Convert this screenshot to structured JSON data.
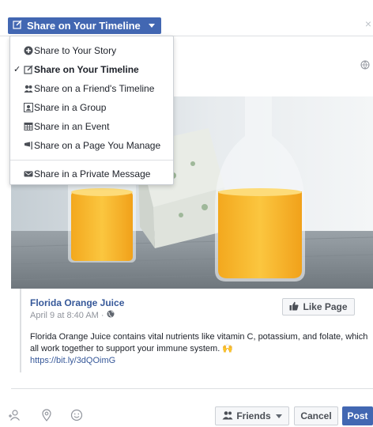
{
  "header": {
    "share_button_label": "Share on Your Timeline",
    "close_label": "×"
  },
  "dropdown": {
    "items": [
      {
        "label": "Share to Your Story",
        "icon": "plus-circle-icon",
        "active": false
      },
      {
        "label": "Share on Your Timeline",
        "icon": "pencil-icon",
        "active": true
      },
      {
        "label": "Share on a Friend's Timeline",
        "icon": "people-icon",
        "active": false
      },
      {
        "label": "Share in a Group",
        "icon": "group-icon",
        "active": false
      },
      {
        "label": "Share in an Event",
        "icon": "calendar-icon",
        "active": false
      },
      {
        "label": "Share on a Page You Manage",
        "icon": "flag-icon",
        "active": false
      },
      {
        "label": "Share in a Private Message",
        "icon": "message-icon",
        "active": false
      }
    ],
    "check_mark": "✓"
  },
  "post": {
    "page_name": "Florida Orange Juice",
    "date": "April 9 at 8:40 AM",
    "date_separator": "·",
    "like_page_label": "Like Page",
    "text": "Florida Orange Juice contains vital nutrients like vitamin C, potassium, and folate, which all work together to support your immune system. 🙌",
    "link": "https://bit.ly/3dQOimG"
  },
  "footer": {
    "audience_label": "Friends",
    "cancel_label": "Cancel",
    "post_label": "Post"
  },
  "colors": {
    "brand_blue": "#4267b2",
    "link_blue": "#365899",
    "border": "#dddfe2"
  }
}
